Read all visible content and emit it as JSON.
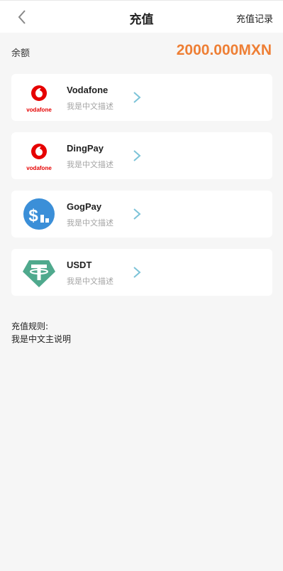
{
  "header": {
    "title": "充值",
    "history_label": "充值记录",
    "back_icon": "chevron-left-icon"
  },
  "balance": {
    "label": "余额",
    "value": "2000.000MXN",
    "color": "#ee7f35"
  },
  "methods": [
    {
      "name": "Vodafone",
      "description": "我是中文描述",
      "icon": "vodafone-logo",
      "logo_text": "vodafone"
    },
    {
      "name": "DingPay",
      "description": "我是中文描述",
      "icon": "vodafone-logo",
      "logo_text": "vodafone"
    },
    {
      "name": "GogPay",
      "description": "我是中文描述",
      "icon": "dollar-chart-logo"
    },
    {
      "name": "USDT",
      "description": "我是中文描述",
      "icon": "tether-logo"
    }
  ],
  "rules": {
    "title": "充值规则:",
    "text": "我是中文主说明"
  }
}
